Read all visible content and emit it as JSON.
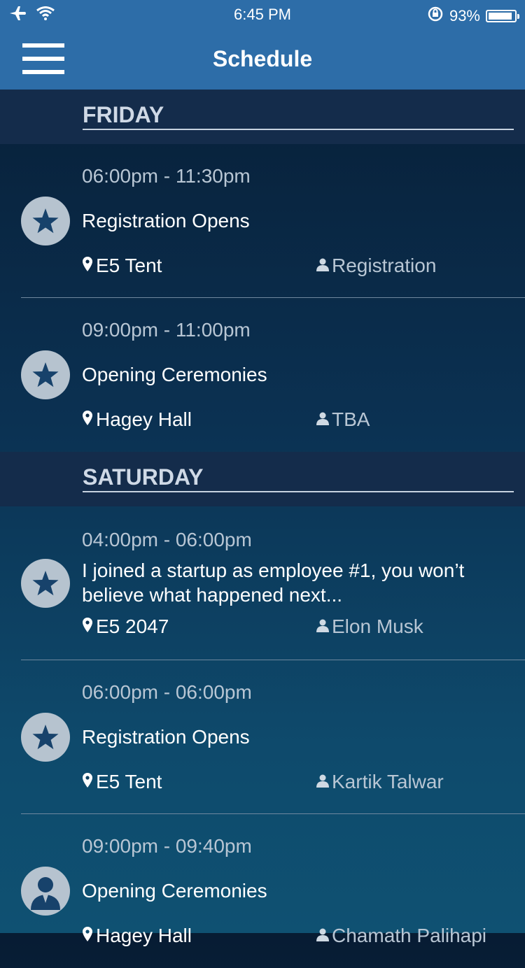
{
  "status_bar": {
    "time": "6:45 PM",
    "battery_label": "93%",
    "battery_level": 0.93
  },
  "nav": {
    "title": "Schedule"
  },
  "days": [
    {
      "label": "FRIDAY",
      "events": [
        {
          "time": "06:00pm - 11:30pm",
          "title": "Registration Opens",
          "location": "E5 Tent",
          "speaker": "Registration",
          "icon": "star-icon"
        },
        {
          "time": "09:00pm - 11:00pm",
          "title": "Opening Ceremonies",
          "location": "Hagey Hall",
          "speaker": "TBA",
          "icon": "star-icon"
        }
      ]
    },
    {
      "label": "SATURDAY",
      "events": [
        {
          "time": "04:00pm - 06:00pm",
          "title": "I joined a startup as employee #1, you won’t believe what happened next...",
          "location": "E5 2047",
          "speaker": "Elon Musk",
          "icon": "star-icon"
        },
        {
          "time": "06:00pm - 06:00pm",
          "title": "Registration Opens",
          "location": "E5 Tent",
          "speaker": "Kartik Talwar",
          "icon": "star-icon"
        },
        {
          "time": "09:00pm - 09:40pm",
          "title": "Opening Ceremonies",
          "location": "Hagey Hall",
          "speaker": "Chamath Palihapi",
          "icon": "speaker-avatar-icon"
        }
      ]
    }
  ],
  "colors": {
    "nav_bg": "#2d6da8",
    "day_header_bg": "#142c4b",
    "icon_circle": "#b6c3cf",
    "muted_text": "#b8c6d4"
  }
}
